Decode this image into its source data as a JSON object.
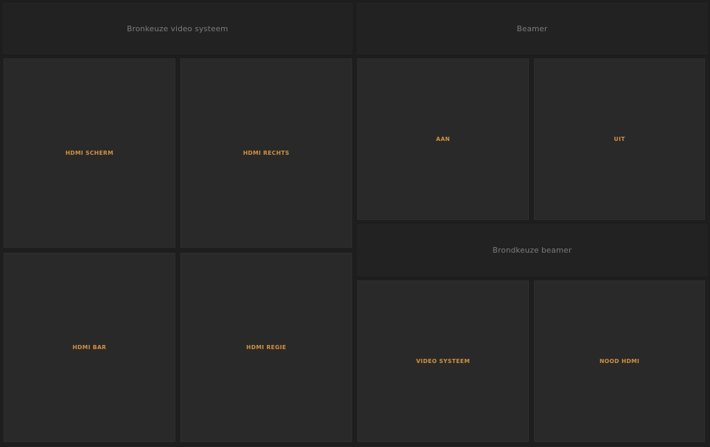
{
  "video_system": {
    "header": "Bronkeuze video systeem",
    "buttons": [
      "HDMI SCHERM",
      "HDMI RECHTS",
      "HDMI BAR",
      "HDMI REGIE"
    ]
  },
  "beamer": {
    "header": "Beamer",
    "buttons": [
      "AAN",
      "UIT"
    ]
  },
  "beamer_source": {
    "header": "Brondkeuze beamer",
    "buttons": [
      "VIDEO SYSTEEM",
      "NOOD HDMI"
    ]
  },
  "colors": {
    "background": "#1e1e1e",
    "panel": "#292929",
    "header_panel": "#222222",
    "header_text": "#7d7d7d",
    "button_text": "#d4923f"
  }
}
